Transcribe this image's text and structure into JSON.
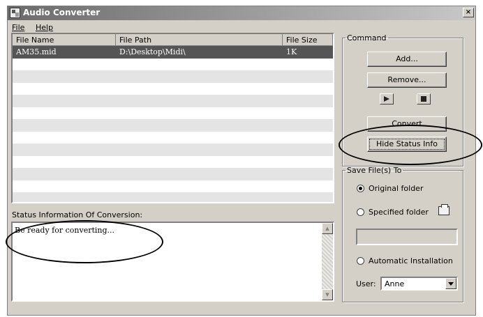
{
  "window": {
    "title": "Audio Converter",
    "close_glyph": "×"
  },
  "menu": [
    {
      "label": "File"
    },
    {
      "label": "Help"
    }
  ],
  "file_list": {
    "columns": [
      "File Name",
      "File Path",
      "File Size"
    ],
    "rows": [
      {
        "name": "AM35.mid",
        "path": "D:\\Desktop\\Midi\\",
        "size": "1K"
      }
    ]
  },
  "status": {
    "label": "Status Information Of Conversion:",
    "text": "Be ready for converting..."
  },
  "command": {
    "legend": "Command",
    "add_label": "Add...",
    "remove_label": "Remove...",
    "convert_label": "Convert",
    "hide_status_label": "Hide Status Info"
  },
  "save": {
    "legend": "Save File(s) To",
    "original_label": "Original folder",
    "specified_label": "Specified folder",
    "automatic_label": "Automatic Installation",
    "selected_option": "original",
    "path_value": "",
    "user_label": "User:",
    "user_value": "Anne"
  },
  "icons": {
    "play": "play-icon",
    "stop": "stop-icon",
    "browse": "folder-icon"
  },
  "colors": {
    "dialog_bg": "#d4d0c8",
    "selected_row": "#555555",
    "alt_row": "#e4e4e4"
  }
}
